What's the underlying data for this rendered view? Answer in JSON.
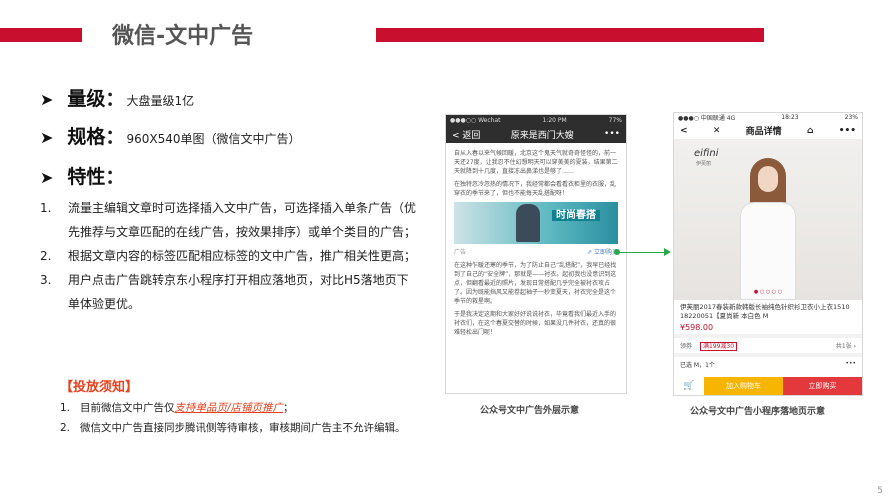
{
  "header": {
    "title": "微信-文中广告"
  },
  "bullets": [
    {
      "label": "量级",
      "value": "大盘量级1亿"
    },
    {
      "label": "规格",
      "value": "960X540单图（微信文中广告）"
    },
    {
      "label": "特性",
      "value": ""
    }
  ],
  "features": [
    {
      "num": "1.",
      "text": "流量主编辑文章时可选择插入文中广告，可选择插入单条广告（优先推荐与文章匹配的在线广告，按效果排序）或单个类目的广告；"
    },
    {
      "num": "2.",
      "text": "根据文章内容的标签匹配相应标签的文中广告，推广相关性更高；"
    },
    {
      "num": "3.",
      "text": "用户点击广告跳转京东小程序打开相应落地页，对比H5落地页下单体验更优。"
    }
  ],
  "notice": {
    "title": "【投放须知】",
    "items": [
      {
        "num": "1.",
        "prefix": "目前微信文中广告仅",
        "link": "支持单品页/店铺页推广",
        "suffix": "；"
      },
      {
        "num": "2.",
        "prefix": "微信文中广告直接同步腾讯侧等待审核，审核期间广告主不允许编辑。",
        "link": "",
        "suffix": ""
      }
    ]
  },
  "phone1": {
    "status_left": "●●●○○ Wechat",
    "status_time": "1:20 PM",
    "status_right": "77%",
    "back": "< 返回",
    "title": "原来是西门大嫂",
    "more": "•••",
    "para1": "自从入春以来气候回暖，北京这个鬼天气就奇奇怪怪的，前一天还27度，让我忍不住幻想明天可以穿美美的夏装，结果第二天就降到十几度，直接冻出鼻涕也是够了……",
    "para2": "在独特忽冷忽热的情况下，我经常都会看看衣柜里的衣服，乱穿衣的季节来了，但也不能每天乱搭配呀！",
    "ad_slogan": "时尚春搭",
    "ad_label": "广告",
    "ad_buy": "⇗ 立即购买",
    "para3": "在这种乍暖还寒的季节，为了防止自己“乱搭配”，我早已经找到了自己的“安全牌”，那就是——衬衣。起初我也没意识到这点，但翻看最近的照片，发现日常搭配几乎完全被衬衣攻占了。因为既能挡风又能卷起袖子一秒变夏天，衬衣完全是这个季节的救星啊。",
    "para4": "于是我决定这期和大家好好说说衬衣，毕竟看我们最近入手的衬衣们，在这个春夏交替的时候，如果没几件衬衣，还真的很难轻松出门呢！",
    "caption": "公众号文中广告外层示意"
  },
  "phone2": {
    "status_left": "●●●○ 中国联通 4G",
    "status_time": "18:23",
    "status_right": "23%",
    "back": "<",
    "close": "✕",
    "title": "商品详情",
    "home": "⌂",
    "more": "•••",
    "brand": "eifini",
    "brand_sub": "伊芙丽",
    "product_name": "伊芙丽2017春装新款韩版长袖纯色针织衫卫衣小上衣1510 18220051【夏尚新 本白色 M",
    "price": "¥598.00",
    "coupon_label": "领券",
    "coupon_tag": "满199减30",
    "coupon_more": "共1张 ›",
    "spec_label": "已选  M，1个",
    "spec_more": "•••",
    "cart_icon": "🛒",
    "add_cart": "加入购物车",
    "buy_now": "立即购买",
    "caption": "公众号文中广告小程序落地页示意"
  },
  "slide_number": "5"
}
